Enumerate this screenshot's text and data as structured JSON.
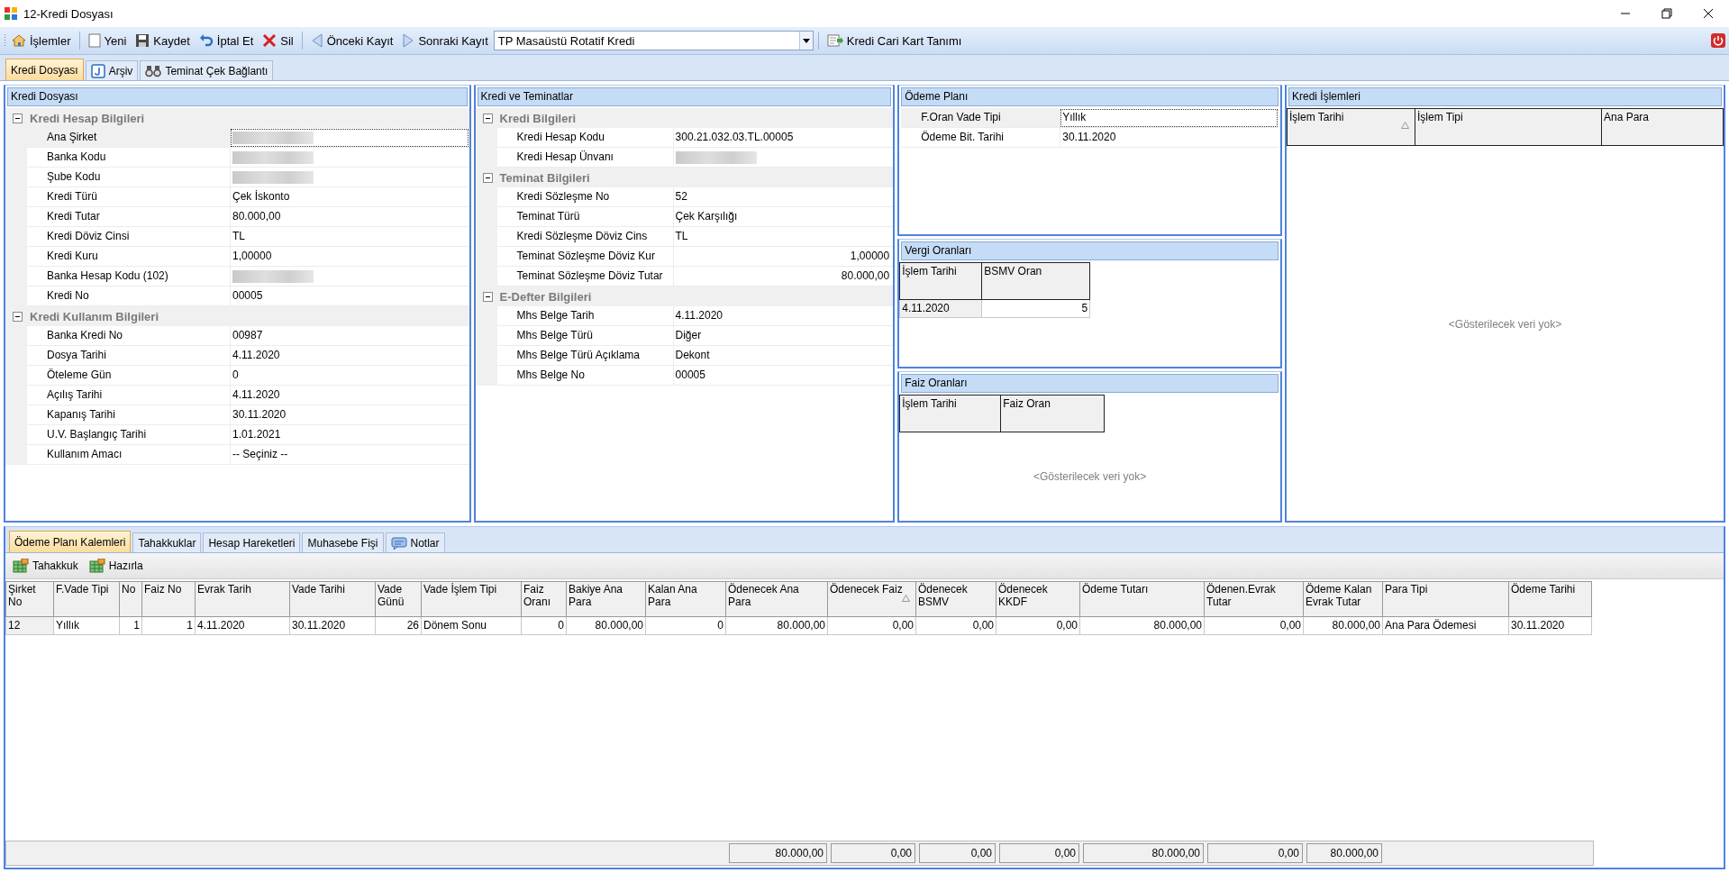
{
  "window": {
    "title": "12-Kredi Dosyası"
  },
  "toolbar": {
    "items": [
      {
        "label": "İşlemler"
      },
      {
        "label": "Yeni"
      },
      {
        "label": "Kaydet"
      },
      {
        "label": "İptal Et"
      },
      {
        "label": "Sil"
      },
      {
        "label": "Önceki Kayıt"
      },
      {
        "label": "Sonraki Kayıt"
      }
    ],
    "record_select": {
      "value": "TP Masaüstü Rotatif Kredi"
    },
    "extra_button": {
      "label": "Kredi Cari Kart Tanımı"
    }
  },
  "tabs": [
    {
      "label": "Kredi Dosyası",
      "selected": true
    },
    {
      "label": "Arşiv",
      "selected": false
    },
    {
      "label": "Teminat Çek Bağlantı",
      "selected": false
    }
  ],
  "kredi_dosyasi": {
    "title": "Kredi Dosyası",
    "sections": [
      {
        "title": "Kredi Hesap Bilgileri",
        "expanded": true,
        "rows": [
          {
            "label": "Ana Şirket",
            "kind": "masked",
            "selected": true
          },
          {
            "label": "Banka Kodu",
            "kind": "masked",
            "selected": false
          },
          {
            "label": "Şube Kodu",
            "kind": "masked",
            "selected": false
          },
          {
            "label": "Kredi Türü",
            "value": "Çek İskonto",
            "kind": "text",
            "selected": false
          },
          {
            "label": "Kredi Tutar",
            "value": "80.000,00",
            "kind": "text",
            "selected": false
          },
          {
            "label": "Kredi Döviz Cinsi",
            "value": "TL",
            "kind": "text",
            "selected": false
          },
          {
            "label": "Kredi Kuru",
            "value": "1,00000",
            "kind": "text",
            "selected": false
          },
          {
            "label": "Banka Hesap Kodu (102)",
            "kind": "masked",
            "selected": false
          },
          {
            "label": "Kredi No",
            "value": "00005",
            "kind": "text",
            "selected": false
          }
        ]
      },
      {
        "title": "Kredi Kullanım Bilgileri",
        "expanded": true,
        "rows": [
          {
            "label": "Banka Kredi No",
            "value": "00987",
            "kind": "text",
            "selected": false
          },
          {
            "label": "Dosya Tarihi",
            "value": "4.11.2020",
            "kind": "text",
            "selected": false
          },
          {
            "label": "Öteleme Gün",
            "value": "0",
            "kind": "text",
            "selected": false
          },
          {
            "label": "Açılış Tarihi",
            "value": "4.11.2020",
            "kind": "text",
            "selected": false
          },
          {
            "label": "Kapanış Tarihi",
            "value": "30.11.2020",
            "kind": "text",
            "selected": false
          },
          {
            "label": "U.V. Başlangıç Tarihi",
            "value": "1.01.2021",
            "kind": "text",
            "selected": false
          },
          {
            "label": "Kullanım Amacı",
            "value": "-- Seçiniz --",
            "kind": "text",
            "selected": false
          }
        ]
      }
    ]
  },
  "kredi_ve_teminatlar": {
    "title": "Kredi ve Teminatlar",
    "sections": [
      {
        "title": "Kredi Bilgileri",
        "expanded": true,
        "rows": [
          {
            "label": "Kredi Hesap Kodu",
            "value": "300.21.032.03.TL.00005",
            "kind": "text",
            "selected": false
          },
          {
            "label": "Kredi Hesap Ünvanı",
            "kind": "masked",
            "selected": false
          }
        ]
      },
      {
        "title": "Teminat Bilgileri",
        "expanded": true,
        "rows": [
          {
            "label": "Kredi Sözleşme No",
            "value": "52",
            "kind": "text",
            "selected": false
          },
          {
            "label": "Teminat Türü",
            "value": "Çek Karşılığı",
            "kind": "text",
            "selected": false
          },
          {
            "label": "Kredi Sözleşme Döviz Cins",
            "value": "TL",
            "kind": "text",
            "selected": false
          },
          {
            "label": "Teminat Sözleşme Döviz Kur",
            "value": "1,00000",
            "kind": "number",
            "selected": false
          },
          {
            "label": "Teminat Sözleşme Döviz Tutar",
            "value": "80.000,00",
            "kind": "number",
            "selected": false
          }
        ]
      },
      {
        "title": "E-Defter Bilgileri",
        "expanded": true,
        "rows": [
          {
            "label": "Mhs Belge Tarih",
            "value": "4.11.2020",
            "kind": "text",
            "selected": false
          },
          {
            "label": "Mhs Belge Türü",
            "value": "Diğer",
            "kind": "text",
            "selected": false
          },
          {
            "label": "Mhs Belge Türü Açıklama",
            "value": "Dekont",
            "kind": "text",
            "selected": false
          },
          {
            "label": "Mhs Belge No",
            "value": "00005",
            "kind": "text",
            "selected": false
          }
        ]
      }
    ]
  },
  "odeme_plani": {
    "title": "Ödeme Planı",
    "rows": [
      {
        "label": "F.Oran Vade Tipi",
        "value": "Yıllık",
        "selected": true
      },
      {
        "label": "Ödeme Bit. Tarihi",
        "value": "30.11.2020",
        "selected": false
      }
    ]
  },
  "vergi_oranlari": {
    "title": "Vergi Oranları",
    "columns": [
      {
        "label": "İşlem Tarihi",
        "kind": "text",
        "sorted": false
      },
      {
        "label": "BSMV Oran",
        "kind": "number",
        "sorted": false
      }
    ],
    "rows": [
      [
        "4.11.2020",
        "5"
      ]
    ]
  },
  "faiz_oranlari": {
    "title": "Faiz Oranları",
    "columns": [
      {
        "label": "İşlem Tarihi",
        "sorted": false
      },
      {
        "label": "Faiz Oran",
        "sorted": false
      }
    ],
    "empty_text": "<Gösterilecek veri yok>"
  },
  "kredi_islemleri": {
    "title": "Kredi İşlemleri",
    "columns": [
      {
        "label": "İşlem Tarihi",
        "sorted": true
      },
      {
        "label": "İşlem Tipi",
        "sorted": false
      },
      {
        "label": "Ana Para",
        "sorted": false
      }
    ],
    "empty_text": "<Gösterilecek veri yok>"
  },
  "bottom_tabs": [
    {
      "label": "Ödeme Planı Kalemleri",
      "selected": true
    },
    {
      "label": "Tahakkuklar",
      "selected": false
    },
    {
      "label": "Hesap Hareketleri",
      "selected": false
    },
    {
      "label": "Muhasebe Fişi",
      "selected": false
    },
    {
      "label": "Notlar",
      "selected": false
    }
  ],
  "bottom_toolbar": [
    {
      "label": "Tahakkuk"
    },
    {
      "label": "Hazırla"
    }
  ],
  "table": {
    "columns": [
      {
        "label": "Şirket No",
        "kind": "text",
        "sorted": false
      },
      {
        "label": "F.Vade Tipi",
        "kind": "text",
        "sorted": false
      },
      {
        "label": "No",
        "kind": "number",
        "sorted": false
      },
      {
        "label": "Faiz No",
        "kind": "number",
        "sorted": false
      },
      {
        "label": "Evrak Tarih",
        "kind": "text",
        "sorted": false
      },
      {
        "label": "Vade Tarihi",
        "kind": "text",
        "sorted": false
      },
      {
        "label": "Vade Günü",
        "kind": "number",
        "sorted": false
      },
      {
        "label": "Vade İşlem Tipi",
        "kind": "text",
        "sorted": false
      },
      {
        "label": "Faiz Oranı",
        "kind": "number",
        "sorted": false
      },
      {
        "label": "Bakiye Ana Para",
        "kind": "number",
        "sorted": false
      },
      {
        "label": "Kalan Ana Para",
        "kind": "number",
        "sorted": false
      },
      {
        "label": "Ödenecek Ana Para",
        "kind": "number",
        "sorted": false,
        "total": "80.000,00"
      },
      {
        "label": "Ödenecek Faiz",
        "kind": "number",
        "sorted": true,
        "total": "0,00"
      },
      {
        "label": "Ödenecek BSMV",
        "kind": "number",
        "sorted": false,
        "total": "0,00"
      },
      {
        "label": "Ödenecek KKDF",
        "kind": "number",
        "sorted": false,
        "total": "0,00"
      },
      {
        "label": "Ödeme Tutarı",
        "kind": "number",
        "sorted": false,
        "total": "80.000,00"
      },
      {
        "label": "Ödenen.Evrak Tutar",
        "kind": "number",
        "sorted": false,
        "total": "0,00"
      },
      {
        "label": "Ödeme Kalan Evrak Tutar",
        "kind": "number",
        "sorted": false,
        "total": "80.000,00"
      },
      {
        "label": "Para Tipi",
        "kind": "text",
        "sorted": false
      },
      {
        "label": "Ödeme Tarihi",
        "kind": "text",
        "sorted": false
      }
    ],
    "rows": [
      [
        "12",
        "Yıllık",
        "1",
        "1",
        "4.11.2020",
        "30.11.2020",
        "26",
        "Dönem Sonu",
        "0",
        "80.000,00",
        "0",
        "80.000,00",
        "0,00",
        "0,00",
        "0,00",
        "80.000,00",
        "0,00",
        "80.000,00",
        "Ana Para Ödemesi",
        "30.11.2020"
      ]
    ]
  }
}
